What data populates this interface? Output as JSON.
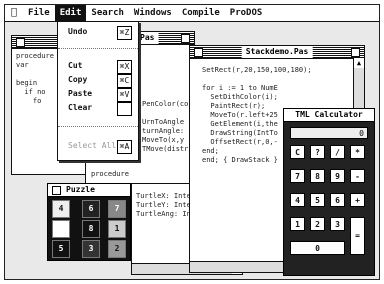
{
  "menubar": {
    "apple": "",
    "items": [
      "File",
      "Edit",
      "Search",
      "Windows",
      "Compile",
      "ProDOS"
    ],
    "active_index": 1
  },
  "edit_menu": {
    "items": [
      {
        "label": "Undo",
        "key": "⌘Z",
        "enabled": true
      },
      {
        "label": "Cut",
        "key": "⌘X",
        "enabled": true
      },
      {
        "label": "Copy",
        "key": "⌘C",
        "enabled": true
      },
      {
        "label": "Paste",
        "key": "⌘V",
        "enabled": true
      },
      {
        "label": "Clear",
        "key": "",
        "enabled": true
      },
      {
        "label": "Select All",
        "key": "⌘A",
        "enabled": false
      }
    ]
  },
  "back_window": {
    "code": "procedure\nvar\n\nbegin\n  if no\n    fo"
  },
  "mid_window": {
    "title": "Do.Pas",
    "code": "PenColor(co\n\nUrnToAngle\nturnAngle:\nMoveTo(x,y\nTMove(distr"
  },
  "procedure_label": "procedure",
  "turtle_window": {
    "code": "TurtleX: Inte\nTurtleY: Inte\nTurtleAng: In"
  },
  "stackdemo_window": {
    "title": "Stackdemo.Pas",
    "code": "SetRect(r,20,150,100,180);\n\nfor i := 1 to NumE\n  SetDithColor(i);\n  PaintRect(r);\n  MoveTo(r.left+25\n  GetElement(i,the\n  DrawString(IntTo\n  OffsetRect(r,0,-\nend;\nend; { DrawStack }"
  },
  "calculator": {
    "title": "TML Calculator",
    "display": "0",
    "keys": [
      [
        "C",
        "?",
        "/",
        "*"
      ],
      [
        "7",
        "8",
        "9",
        "-"
      ],
      [
        "4",
        "5",
        "6",
        "+"
      ],
      [
        "1",
        "2",
        "3",
        "="
      ],
      [
        "0",
        ".",
        "",
        ""
      ]
    ]
  },
  "puzzle": {
    "title": "Puzzle",
    "tiles": [
      "4",
      "6",
      "7",
      "",
      "8",
      "1",
      "5",
      "3",
      "2"
    ]
  }
}
